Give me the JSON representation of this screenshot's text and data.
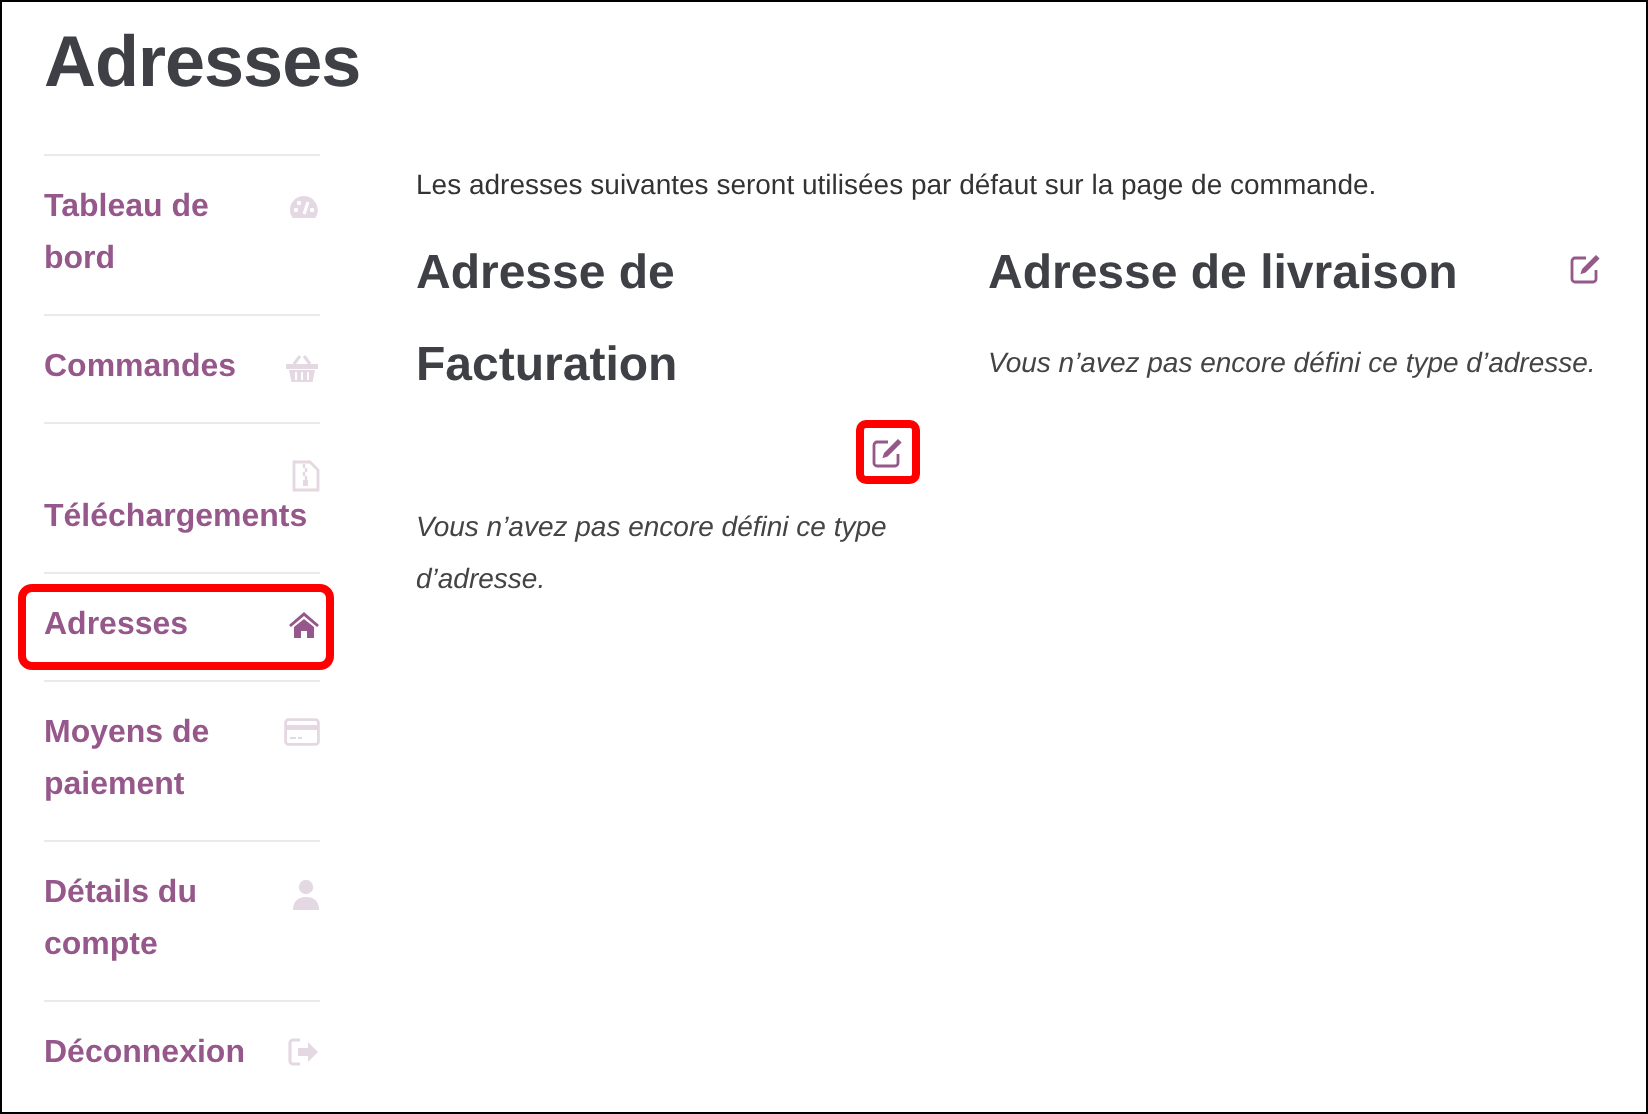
{
  "page_title": "Adresses",
  "nav": [
    {
      "label": "Tableau de bord",
      "selected": false,
      "highlighted": false
    },
    {
      "label": "Commandes",
      "selected": false,
      "highlighted": false
    },
    {
      "label": "Téléchargements",
      "selected": false,
      "highlighted": false
    },
    {
      "label": "Adresses",
      "selected": true,
      "highlighted": true
    },
    {
      "label": "Moyens de paiement",
      "selected": false,
      "highlighted": false
    },
    {
      "label": "Détails du compte",
      "selected": false,
      "highlighted": false
    },
    {
      "label": "Déconnexion",
      "selected": false,
      "highlighted": false
    }
  ],
  "intro": "Les adresses suivantes seront utilisées par défaut sur la page de commande.",
  "addresses": [
    {
      "title": "Adresse de Facturation",
      "empty_text": "Vous n’avez pas encore défini ce type d’adresse.",
      "edit_highlighted": true
    },
    {
      "title": "Adresse de livraison",
      "empty_text": "Vous n’avez pas encore défini ce type d’adresse.",
      "edit_highlighted": false
    }
  ]
}
